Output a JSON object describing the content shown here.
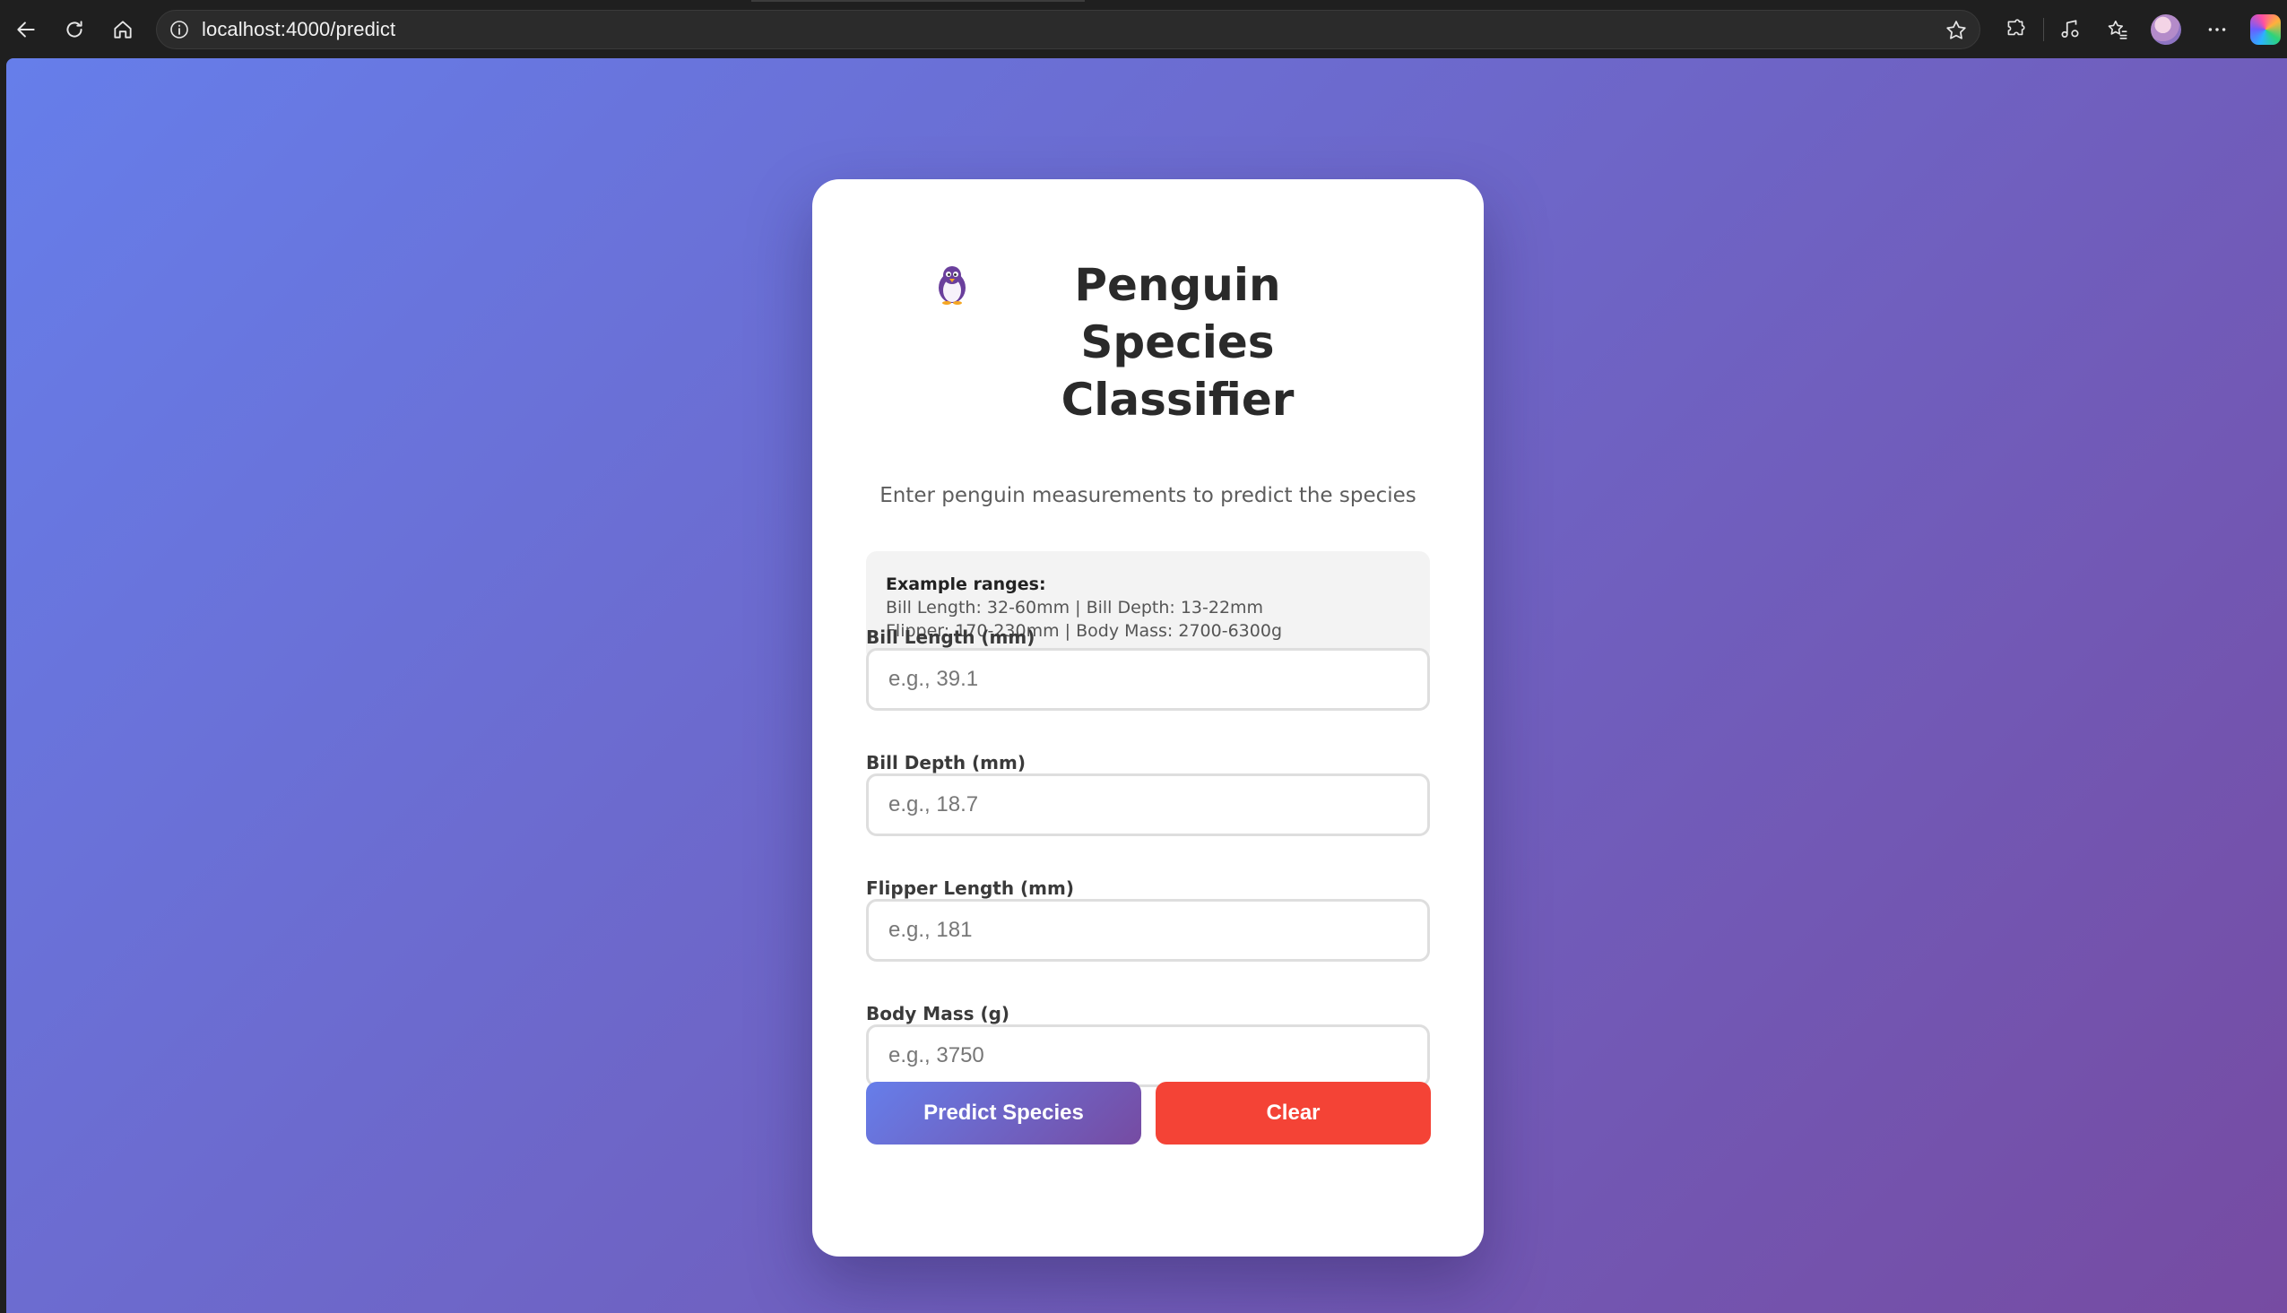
{
  "browser": {
    "url": "localhost:4000/predict"
  },
  "page": {
    "title": "Penguin Species Classifier",
    "subtitle": "Enter penguin measurements to predict the species",
    "example_ranges": {
      "heading": "Example ranges:",
      "line1": "Bill Length: 32-60mm | Bill Depth: 13-22mm",
      "line2": "Flipper: 170-230mm | Body Mass: 2700-6300g"
    },
    "fields": [
      {
        "label": "Bill Length (mm)",
        "placeholder": "e.g., 39.1",
        "value": ""
      },
      {
        "label": "Bill Depth (mm)",
        "placeholder": "e.g., 18.7",
        "value": ""
      },
      {
        "label": "Flipper Length (mm)",
        "placeholder": "e.g., 181",
        "value": ""
      },
      {
        "label": "Body Mass (g)",
        "placeholder": "e.g., 3750",
        "value": ""
      }
    ],
    "buttons": {
      "predict": "Predict Species",
      "clear": "Clear"
    }
  },
  "colors": {
    "gradient_start": "#667eea",
    "gradient_end": "#764ba2",
    "clear_button": "#f44336"
  },
  "icons": {
    "title_icon": "penguin-icon"
  }
}
